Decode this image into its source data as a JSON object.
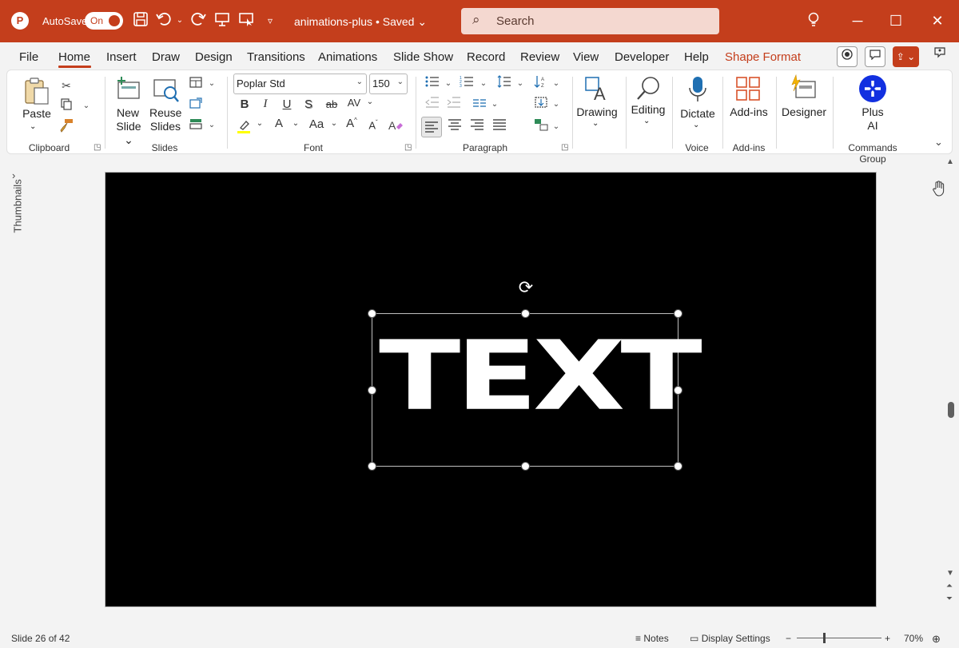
{
  "titlebar": {
    "app_letter": "P",
    "autosave_label": "AutoSave",
    "autosave_state": "On",
    "document_title": "animations-plus • Saved",
    "search_placeholder": "Search",
    "qat_icons": [
      "save-icon",
      "undo-icon",
      "redo-icon",
      "present-from-beginning-icon",
      "present-icon",
      "customize-qat-icon"
    ],
    "window_icons": [
      "lightbulb-icon",
      "minimize-icon",
      "maximize-icon",
      "close-icon"
    ],
    "brand_color": "#c43e1c"
  },
  "menu": {
    "tabs": [
      "File",
      "Home",
      "Insert",
      "Draw",
      "Design",
      "Transitions",
      "Animations",
      "Slide Show",
      "Record",
      "Review",
      "View",
      "Developer",
      "Help"
    ],
    "active_tab": "Home",
    "contextual_tab": "Shape Format",
    "right_icons": [
      "record-icon",
      "comments-icon",
      "share-icon",
      "coauthor-icon"
    ]
  },
  "ribbon": {
    "clipboard": {
      "paste_label": "Paste",
      "group_label": "Clipboard",
      "icons": [
        "paste-icon",
        "cut-icon",
        "copy-icon",
        "format-painter-icon"
      ]
    },
    "slides": {
      "new_slide_label_1": "New",
      "new_slide_label_2": "Slide",
      "reuse_label_1": "Reuse",
      "reuse_label_2": "Slides",
      "group_label": "Slides",
      "icons": [
        "new-slide-icon",
        "reuse-slides-icon",
        "layout-icon",
        "reset-icon",
        "section-icon"
      ]
    },
    "font": {
      "font_name": "Poplar Std",
      "font_size": "150",
      "group_label": "Font",
      "bold": "B",
      "italic": "I",
      "underline": "U",
      "shadow": "S",
      "strike": "ab",
      "spacing": "AV",
      "font_color": "A",
      "change_case": "Aa",
      "grow": "A",
      "shrink": "A",
      "highlight_color": "#ffff00"
    },
    "paragraph": {
      "group_label": "Paragraph",
      "icons": [
        "bullets-icon",
        "numbering-icon",
        "line-spacing-icon",
        "decrease-indent-icon",
        "increase-indent-icon",
        "columns-icon",
        "text-direction-icon",
        "align-text-icon",
        "smartart-icon",
        "align-left-icon",
        "center-icon",
        "align-right-icon",
        "justify-icon"
      ]
    },
    "drawing": {
      "label": "Drawing"
    },
    "editing": {
      "label": "Editing"
    },
    "voice": {
      "dictate_label": "Dictate",
      "group_label": "Voice"
    },
    "addins": {
      "label": "Add-ins",
      "group_label": "Add-ins"
    },
    "designer": {
      "label": "Designer"
    },
    "commands": {
      "plus_label_1": "Plus",
      "plus_label_2": "AI",
      "group_label": "Commands Group",
      "plus_color": "#1230e0"
    }
  },
  "thumbnails": {
    "label": "Thumbnails"
  },
  "slide": {
    "text": "TEXT",
    "background": "#000000"
  },
  "status": {
    "slide_info": "Slide 26 of 42",
    "notes_label": "Notes",
    "display_settings_label": "Display Settings",
    "zoom_minus": "−",
    "zoom_plus": "+",
    "zoom_level": "70%"
  }
}
